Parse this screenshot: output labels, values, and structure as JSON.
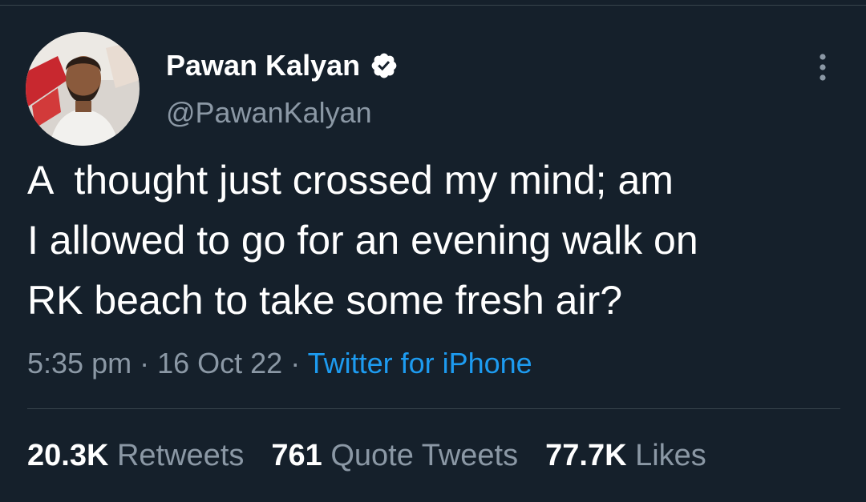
{
  "user": {
    "display_name": "Pawan Kalyan",
    "handle": "@PawanKalyan",
    "verified": true
  },
  "tweet": {
    "text": "A  thought just crossed my mind; am\nI allowed to go for an evening walk on\nRK beach to take some fresh air?",
    "time": "5:35 pm",
    "date": "16 Oct 22",
    "separator": "·",
    "source": "Twitter for iPhone"
  },
  "stats": {
    "retweets_count": "20.3K",
    "retweets_label": "Retweets",
    "quotes_count": "761",
    "quotes_label": "Quote Tweets",
    "likes_count": "77.7K",
    "likes_label": "Likes"
  },
  "icons": {
    "verified": "verified-badge-icon",
    "more": "more-vertical-icon"
  },
  "colors": {
    "background": "#15202b",
    "text_primary": "#ffffff",
    "text_secondary": "#8b98a5",
    "link": "#1d9bf0",
    "divider": "#38444d"
  }
}
